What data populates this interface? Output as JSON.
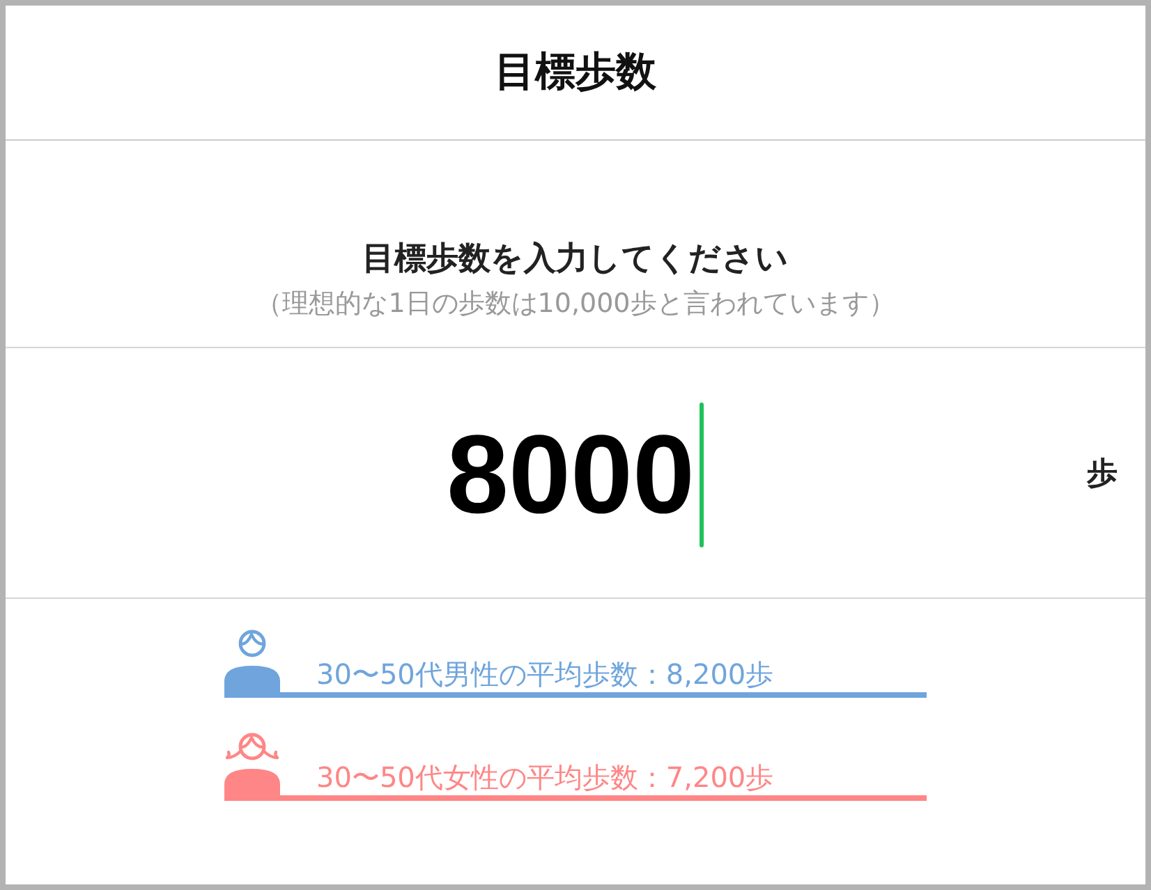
{
  "header": {
    "title": "目標歩数"
  },
  "prompt": {
    "heading": "目標歩数を入力してください",
    "note": "（理想的な1日の歩数は10,000歩と言われています）"
  },
  "input": {
    "value": "8000",
    "focused": true,
    "unit": "歩"
  },
  "averages": [
    {
      "kind": "male",
      "label": "30〜50代男性の平均歩数：8,200歩",
      "color": "#6fa5dc"
    },
    {
      "kind": "female",
      "label": "30〜50代女性の平均歩数：7,200歩",
      "color": "#ff8686"
    }
  ]
}
